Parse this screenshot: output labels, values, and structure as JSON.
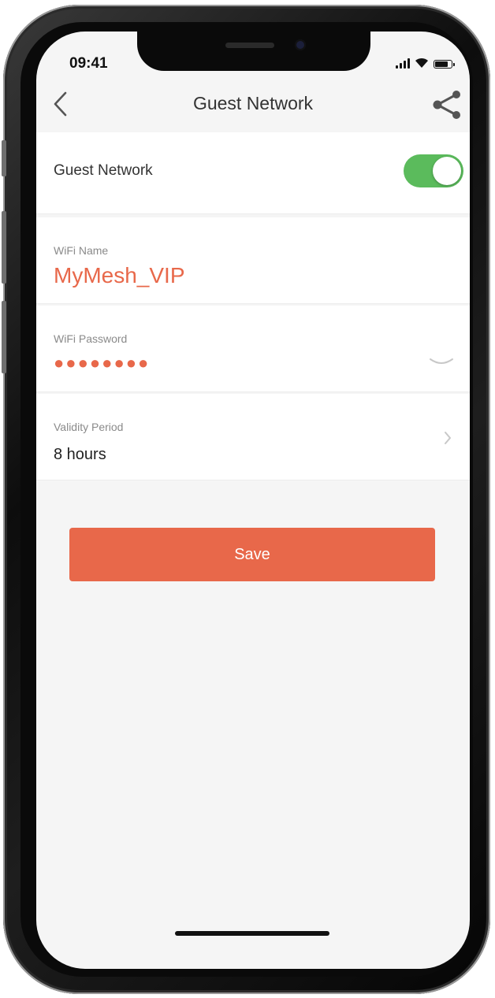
{
  "status_bar": {
    "time": "09:41"
  },
  "navbar": {
    "title": "Guest Network",
    "back_icon": "chevron-left-icon",
    "share_icon": "share-icon"
  },
  "guest_network": {
    "label": "Guest Network",
    "enabled": true
  },
  "wifi_name": {
    "label": "WiFi Name",
    "value": "MyMesh_VIP"
  },
  "wifi_password": {
    "label": "WiFi Password",
    "value": "●●●●●●●●",
    "visibility_icon": "eye-closed-icon"
  },
  "validity_period": {
    "label": "Validity Period",
    "value": "8 hours",
    "chevron_icon": "chevron-right-icon"
  },
  "save_button": {
    "label": "Save"
  },
  "colors": {
    "accent": "#e8684a",
    "toggle_on": "#5bbb5c",
    "background": "#f5f5f5"
  }
}
